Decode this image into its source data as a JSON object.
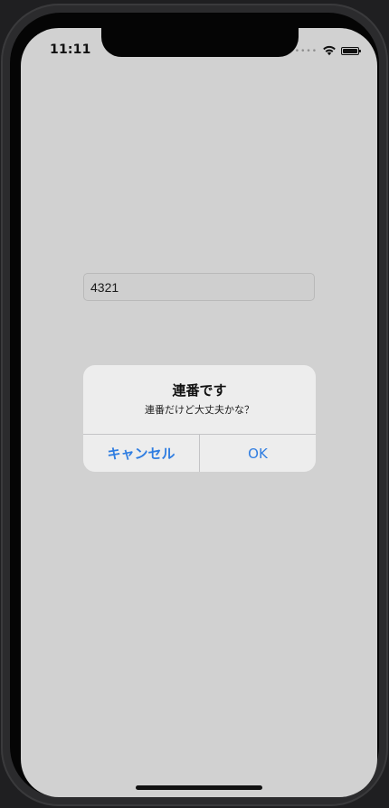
{
  "status_bar": {
    "time": "11:11",
    "signal_icon": "signal-dots-icon",
    "wifi_icon": "wifi-icon",
    "battery_icon": "battery-icon",
    "battery_level": 1.0
  },
  "text_field": {
    "value": "4321"
  },
  "alert": {
    "title": "連番です",
    "message": "連番だけど大丈夫かな？",
    "cancel_label": "キャンセル",
    "ok_label": "OK",
    "button_color": "#2f7de1"
  },
  "colors": {
    "screen_background": "#d1d1d1",
    "alert_background": "#ededed"
  }
}
